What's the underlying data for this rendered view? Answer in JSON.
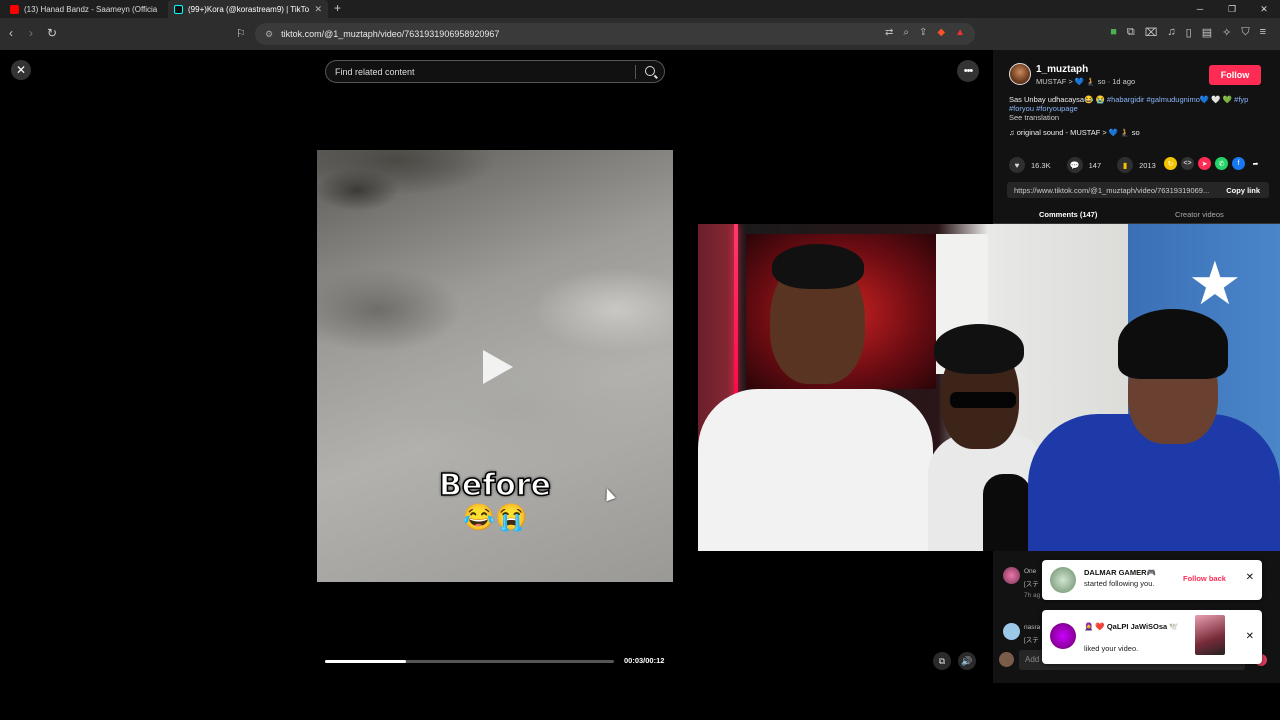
{
  "browser": {
    "tabs": [
      {
        "title": "(13) Hanad Bandz - Saameyn (Officia",
        "favicon_color": "#ff0000"
      },
      {
        "title": "(99+)Kora (@korastream9) | TikTo",
        "favicon_color": "#111111"
      }
    ],
    "url": "tiktok.com/@1_muztaph/video/7631931906958920967"
  },
  "search": {
    "placeholder": "Find related content"
  },
  "video": {
    "overlay_text": "Before",
    "overlay_emojis": "😂😭",
    "time": "00:03/00:12",
    "progress": 0.28
  },
  "post": {
    "username": "1_muztaph",
    "subtitle": "MUSTAF > 💙 🧎 so · 1d ago",
    "follow_label": "Follow",
    "caption_text": "Sas Unbay udhacaysa😂 😭 ",
    "caption_tags": "#habargidir #galmudugnimo💙 🤍 💚 #fyp #foryou #foryoupage",
    "see_translation": "See translation",
    "sound": "♫  original sound - MUSTAF > 💙 🧎 so",
    "likes": "16.3K",
    "comments": "147",
    "saves": "2013",
    "link": "https://www.tiktok.com/@1_muztaph/video/76319319069...",
    "copy_label": "Copy link",
    "tab_comments": "Comments (147)",
    "tab_creator": "Creator videos"
  },
  "comments": [
    {
      "name": "One",
      "text": "[ステ",
      "meta": "7h ag"
    },
    {
      "name": "nasra",
      "text": "[ステ",
      "meta": ""
    }
  ],
  "add_comment": {
    "placeholder": "Add"
  },
  "notifications": [
    {
      "name": "DALMAR GAMER🎮",
      "text": "started following you.",
      "action": "Follow back"
    },
    {
      "name": "🧕 ❤️ QaLPI JaWiSOsa 🕊️",
      "text": "liked your video.",
      "action": ""
    }
  ]
}
